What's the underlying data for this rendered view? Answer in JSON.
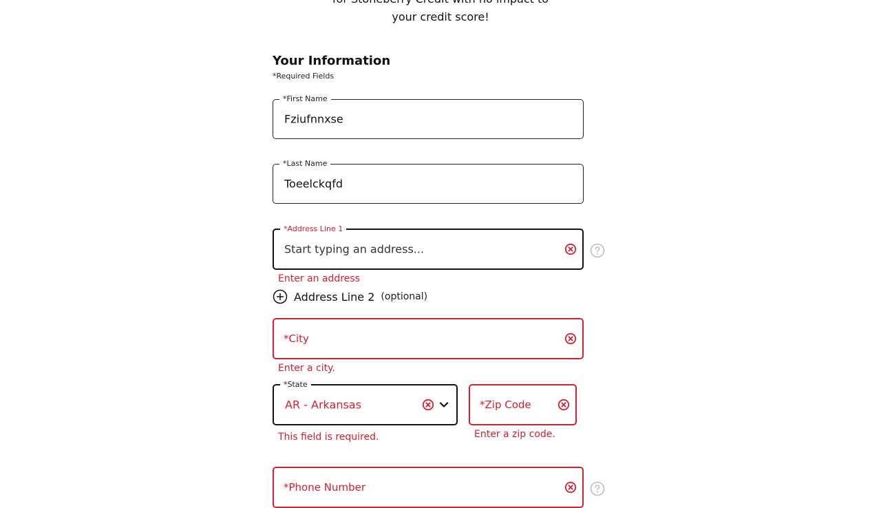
{
  "intro": {
    "line1": "for Stoneberry Credit with no impact to",
    "line2": "your credit score!"
  },
  "section": {
    "title": "Your Information",
    "required_note": "*Required Fields"
  },
  "fields": {
    "first_name": {
      "label": "*First Name",
      "value": "Fziufnnxse"
    },
    "last_name": {
      "label": "*Last Name",
      "value": "Toeelckqfd"
    },
    "address1": {
      "label": "*Address Line 1",
      "value": "",
      "placeholder": "Start typing an address...",
      "error": "Enter an address"
    },
    "address2": {
      "label": "Address Line 2",
      "optional": "(optional)"
    },
    "city": {
      "placeholder": "*City",
      "error": "Enter a city."
    },
    "state": {
      "label": "*State",
      "value": "AR - Arkansas",
      "error": "This field is required."
    },
    "zip": {
      "placeholder": "*Zip Code",
      "error": "Enter a zip code."
    },
    "phone": {
      "placeholder": "*Phone Number"
    }
  },
  "colors": {
    "error": "#d3202f",
    "border": "#222222",
    "help": "#bdbdbd"
  },
  "icons": {
    "clear": "clear-circle-x-icon",
    "help": "question-circle-icon",
    "add": "plus-circle-icon",
    "chevron": "chevron-down-icon"
  }
}
